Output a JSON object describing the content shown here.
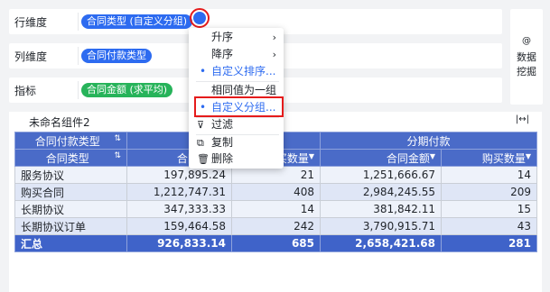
{
  "fields": {
    "row_dimension_label": "行维度",
    "row_dimension_chip": "合同类型 (自定义分组)",
    "col_dimension_label": "列维度",
    "col_dimension_chip": "合同付款类型",
    "metric_label": "指标",
    "metric_chip": "合同金额 (求平均)"
  },
  "right_panel": {
    "icon": "@",
    "label": "数据挖掘"
  },
  "component": {
    "title": "未命名组件2",
    "expand_icon": "|↔|"
  },
  "table": {
    "corner_col_header": "合同付款类型",
    "corner_row_header": "合同类型",
    "group_headers": [
      "",
      "分期付款"
    ],
    "measure_headers": [
      "合同金额",
      "购买数量",
      "合同金额",
      "购买数量"
    ],
    "rows": [
      {
        "name": "服务协议",
        "v1": "197,895.24",
        "v2": "21",
        "v3": "1,251,666.67",
        "v4": "14"
      },
      {
        "name": "购买合同",
        "v1": "1,212,747.31",
        "v2": "408",
        "v3": "2,984,245.55",
        "v4": "209"
      },
      {
        "name": "长期协议",
        "v1": "347,333.33",
        "v2": "14",
        "v3": "381,842.11",
        "v4": "15"
      },
      {
        "name": "长期协议订单",
        "v1": "159,464.58",
        "v2": "242",
        "v3": "3,790,915.71",
        "v4": "43"
      }
    ],
    "total": {
      "name": "汇总",
      "v1": "926,833.14",
      "v2": "685",
      "v3": "2,658,421.68",
      "v4": "281"
    }
  },
  "menu": {
    "items": [
      {
        "label": "升序",
        "arrow": "›"
      },
      {
        "label": "降序",
        "arrow": "›"
      },
      {
        "label": "自定义排序..."
      },
      {
        "label": "相同值为一组"
      },
      {
        "label": "自定义分组..."
      },
      {
        "label": "过滤",
        "icon": "filter-icon"
      },
      {
        "label": "复制",
        "icon": "copy-icon"
      },
      {
        "label": "删除",
        "icon": "trash-icon"
      }
    ]
  }
}
